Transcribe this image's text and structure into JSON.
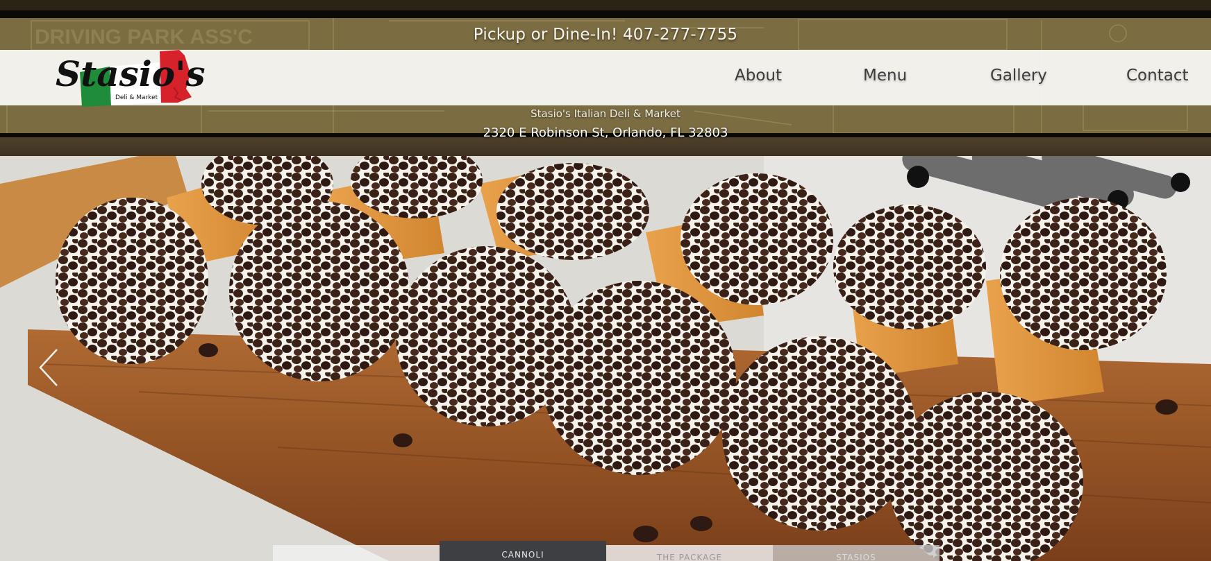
{
  "header": {
    "pickup_text": "Pickup or Dine-In! 407-277-7755",
    "logo": {
      "text": "Stasio's",
      "subtext": "Deli & Market",
      "colors": [
        "#009246",
        "#ffffff",
        "#ce2b37"
      ]
    },
    "nav": [
      {
        "label": "About"
      },
      {
        "label": "Menu"
      },
      {
        "label": "Gallery"
      },
      {
        "label": "Contact"
      }
    ],
    "business_name": "Stasio's Italian Deli & Market",
    "address": "2320 E Robinson St, Orlando, FL 32803",
    "colors": {
      "band": "#7b6c42",
      "navbar": "#f7f6f3"
    }
  },
  "hero": {
    "prev_icon": "chevron-left-icon",
    "tabs": [
      {
        "label": ""
      },
      {
        "label": "CANNOLI"
      },
      {
        "label": "THE PACKAGE"
      },
      {
        "label": "STASIOS"
      }
    ]
  }
}
